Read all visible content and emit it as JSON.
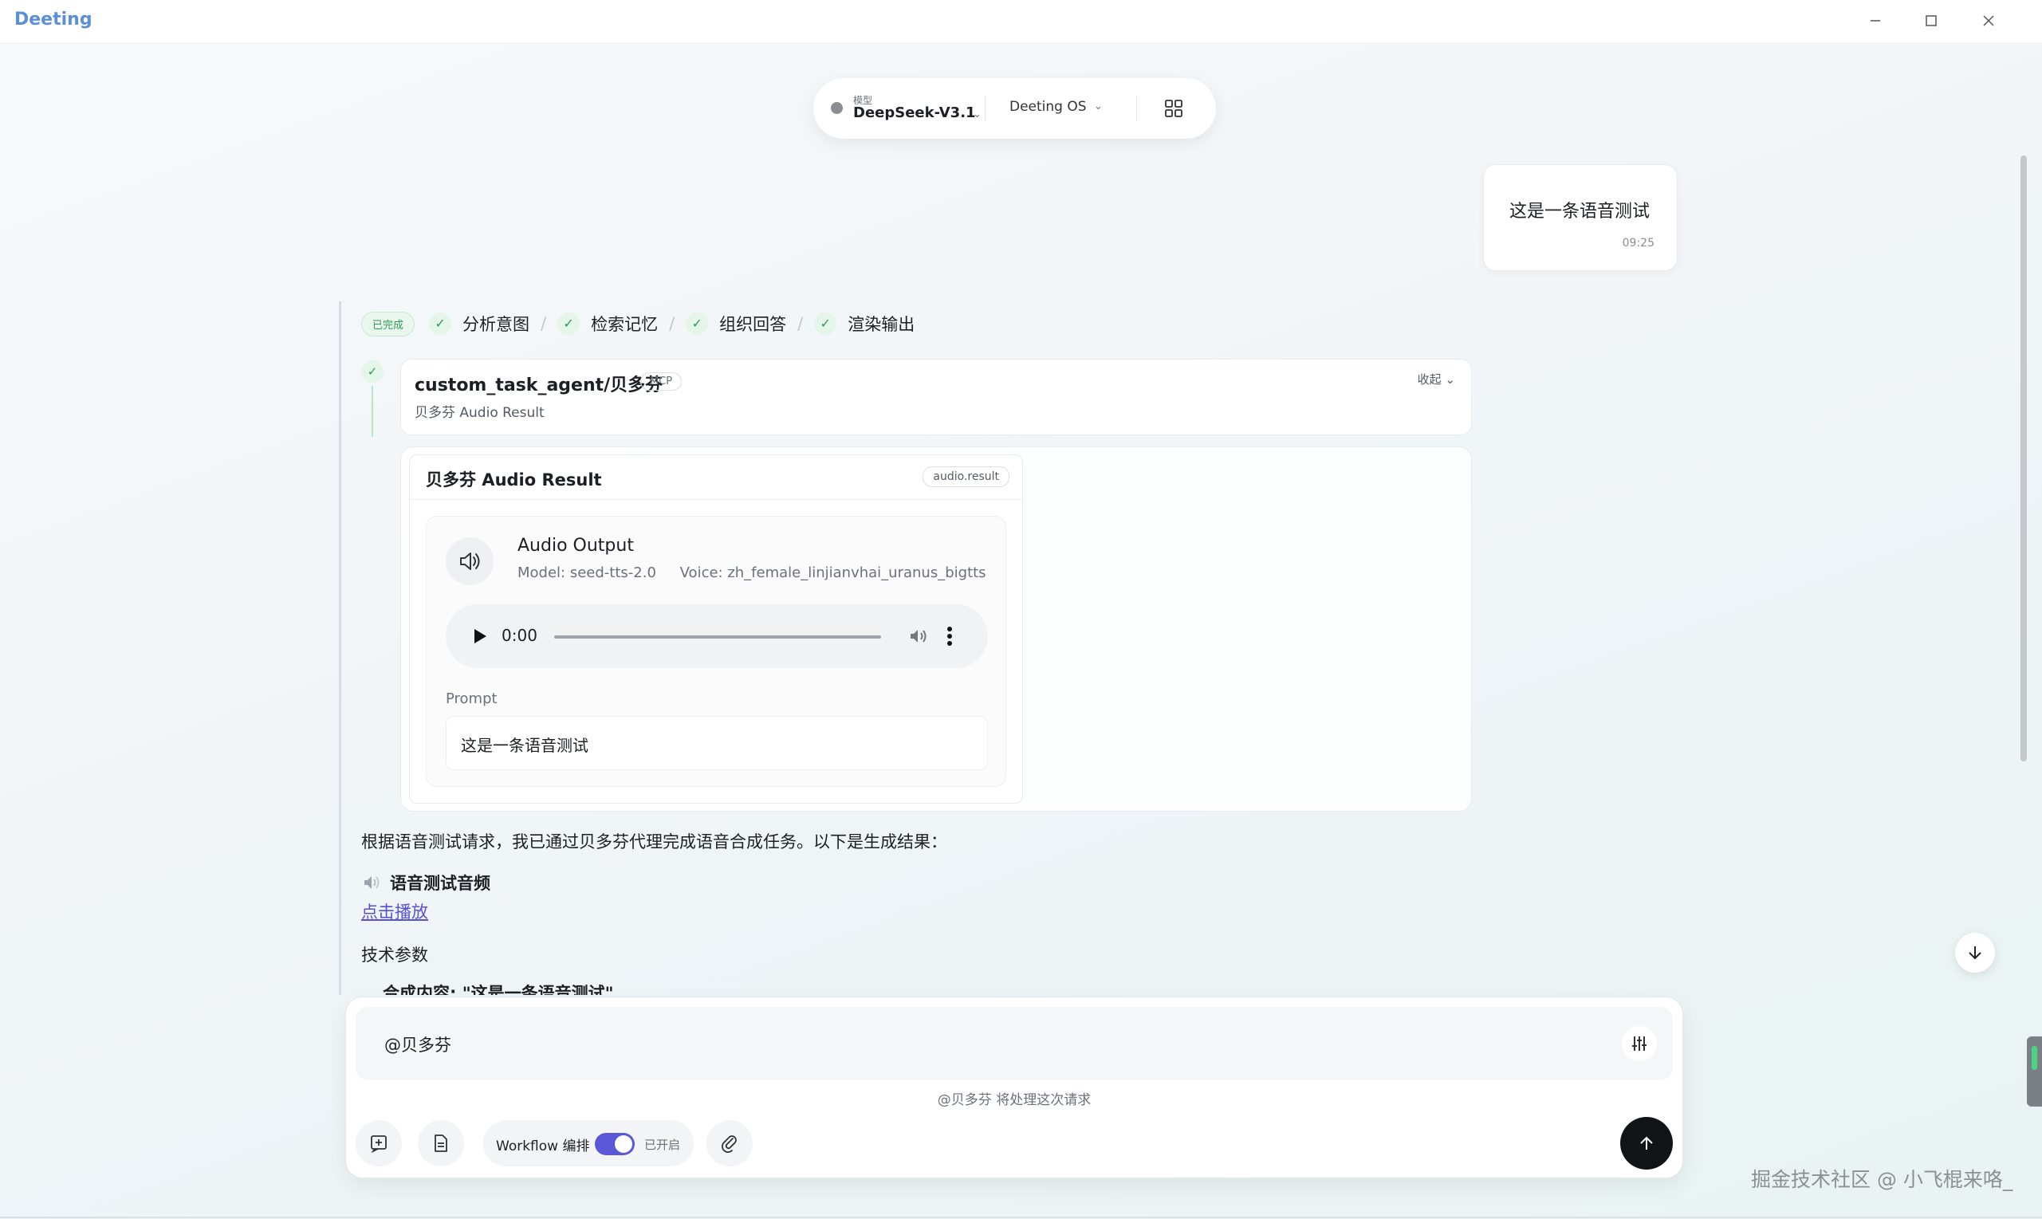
{
  "app": {
    "title": "Deeting",
    "window_controls": [
      "minimize",
      "maximize",
      "close"
    ]
  },
  "model_selector": {
    "caption": "模型",
    "model": "DeepSeek-V3.1",
    "os": "Deeting OS",
    "grid_icon": "grid-icon"
  },
  "user_message": {
    "text": "这是一条语音测试",
    "time": "09:25"
  },
  "status": {
    "done_label": "已完成",
    "steps": [
      "分析意图",
      "检索记忆",
      "组织回答",
      "渲染输出"
    ]
  },
  "agent_call": {
    "name": "custom_task_agent/贝多芬",
    "tag": "MCP",
    "subtitle": "贝多芬 Audio Result",
    "collapse_label": "收起"
  },
  "audio_result": {
    "title": "贝多芬 Audio Result",
    "tag": "audio.result",
    "output_title": "Audio Output",
    "model": "Model: seed-tts-2.0",
    "voice": "Voice: zh_female_linjianvhai_uranus_bigtts",
    "player_time": "0:00",
    "playback_progress": 0,
    "prompt_label": "Prompt",
    "prompt_text": "这是一条语音测试"
  },
  "answer": {
    "intro": "根据语音测试请求，我已通过贝多芬代理完成语音合成任务。以下是生成结果：",
    "heading": "语音测试音频",
    "link": "点击播放",
    "section": "技术参数",
    "cut_line": "合成内容: \"这是一条语音测试\""
  },
  "composer": {
    "input_value": "@贝多芬",
    "hint": "@贝多芬 将处理这次请求",
    "workflow_label": "Workflow 编排",
    "workflow_state": "已开启",
    "workflow_enabled": true
  },
  "watermark": "掘金技术社区 @ 小飞棍来咯_",
  "colors": {
    "accent": "#5b57d9",
    "success": "#2f9b58",
    "link": "#5b4fd6",
    "send": "#111417"
  }
}
